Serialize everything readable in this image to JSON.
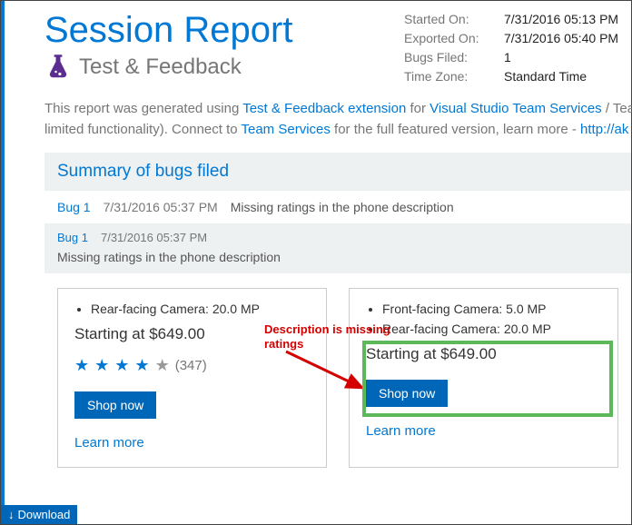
{
  "header": {
    "title": "Session Report",
    "subtitle": "Test & Feedback"
  },
  "meta": {
    "started_label": "Started On:",
    "started_value": "7/31/2016 05:13 PM",
    "exported_label": "Exported On:",
    "exported_value": "7/31/2016 05:40 PM",
    "bugs_label": "Bugs Filed:",
    "bugs_value": "1",
    "tz_label": "Time Zone:",
    "tz_value": "Standard Time"
  },
  "intro": {
    "t1": "This report was generated using ",
    "link1": "Test & Feedback extension",
    "t2": " for ",
    "link2": "Visual Studio Team Services",
    "t3": " / Team",
    "t4": "limited functionality). Connect to ",
    "link3": "Team Services",
    "t5": " for the full featured version, learn more - ",
    "link4": "http://ak"
  },
  "summary_title": "Summary of bugs filed",
  "bug": {
    "link": "Bug 1",
    "time": "7/31/2016 05:37 PM",
    "title": "Missing ratings in the phone description"
  },
  "left_panel": {
    "bullet1": "Rear-facing Camera: 20.0 MP",
    "price": "Starting at $649.00",
    "rating_count": "(347)",
    "shop": "Shop now",
    "learn": "Learn more"
  },
  "right_panel": {
    "bullet1": "Front-facing Camera: 5.0 MP",
    "bullet2": "Rear-facing Camera: 20.0 MP",
    "price": "Starting at $649.00",
    "shop": "Shop now",
    "learn": "Learn more"
  },
  "annotation": "Description is missing ratings",
  "download": "Download"
}
